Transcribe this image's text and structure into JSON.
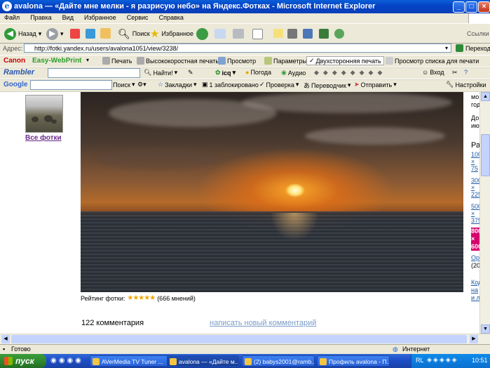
{
  "window": {
    "title": "avalona — «Дайте мне мелки - я разрисую небо» на Яндекс.Фотках - Microsoft Internet Explorer",
    "minimize": "_",
    "maximize": "□",
    "close": "×"
  },
  "menu": [
    "Файл",
    "Правка",
    "Вид",
    "Избранное",
    "Сервис",
    "Справка"
  ],
  "toolbar": {
    "back": "Назад",
    "search": "Поиск",
    "favorites": "Избранное",
    "links": "Ссылки"
  },
  "address": {
    "label": "Адрес:",
    "url": "http://fotki.yandex.ru/users/avalona1051/view/3238/",
    "go": "Переход"
  },
  "canon_bar": {
    "brand": "Canon",
    "product": "Easy-WebPrint",
    "print": "Печать",
    "hq_print": "Высококоростная печать",
    "preview": "Просмотр",
    "params": "Параметры",
    "duplex": "Двухсторонняя печать",
    "print_list": "Просмотр списка для печати"
  },
  "rambler_bar": {
    "logo": "Rambler",
    "find": "Найти!",
    "icq": "icq",
    "weather": "Погода",
    "audio": "Аудио",
    "login": "Вход"
  },
  "google_bar": {
    "logo": "Google",
    "search": "Поиск",
    "bookmarks": "Закладки",
    "blocked": "1 заблокировано",
    "check": "Проверка",
    "translate": "Переводчик",
    "send": "Отправить",
    "settings": "Настройки"
  },
  "page": {
    "all_photos": "Все фотки",
    "rating_label": "Рейтинг фотки:",
    "rating_stars": 5,
    "rating_count": "(666 мнений)",
    "comments_count": "122 комментария",
    "write_comment": "написать новый комментарий"
  },
  "right_column": {
    "t1": "мо",
    "t2": "год",
    "t3": "До",
    "t4": "июн",
    "t5": "Ра",
    "s1": [
      "100",
      "×",
      "75"
    ],
    "s2": [
      "300",
      "×",
      "225"
    ],
    "s3": [
      "500",
      "×",
      "375"
    ],
    "s4": [
      "800",
      "×",
      "600"
    ],
    "orig": "Ори",
    "orig2": "(20-",
    "code": [
      "Код",
      "на",
      "и л"
    ]
  },
  "statusbar": {
    "status": "Готово",
    "zone": "Интернет"
  },
  "taskbar": {
    "start": "пуск",
    "tasks": [
      "AVerMedia TV Tuner ...",
      "avalona — «Дайте м...",
      "(2) babys2001@ramb...",
      "Профиль avalona - П..."
    ],
    "lang": "RL",
    "clock": "10:51"
  },
  "colors": {
    "title_blue": "#0442c4",
    "link": "#1f5aa6",
    "star": "#f0a500",
    "badge": "#d6006e"
  }
}
